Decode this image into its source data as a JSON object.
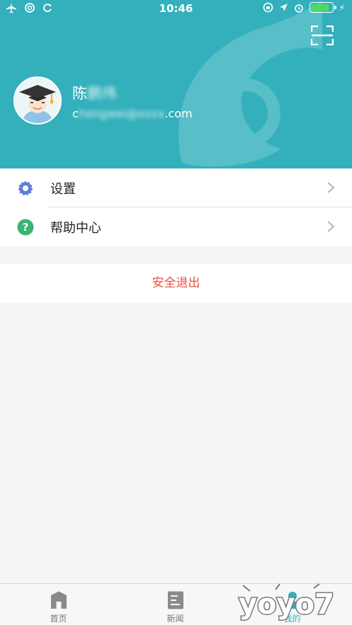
{
  "status_bar": {
    "time": "10:46"
  },
  "profile": {
    "name_visible": "陈",
    "name_blurred": "鹏伟",
    "email_start": "c",
    "email_blurred": "hengwei@xxxx",
    "email_end": ".com"
  },
  "menu": {
    "items": [
      {
        "label": "设置",
        "icon": "gear-icon",
        "icon_color": "#5b7fd6"
      },
      {
        "label": "帮助中心",
        "icon": "help-icon",
        "icon_color": "#3cb371"
      }
    ]
  },
  "logout": {
    "label": "安全退出",
    "color": "#e8533e"
  },
  "tabbar": {
    "tabs": [
      {
        "label": "首页",
        "icon": "home-icon"
      },
      {
        "label": "新闻",
        "icon": "news-icon"
      },
      {
        "label": "我的",
        "icon": "profile-icon",
        "active": true
      }
    ]
  },
  "colors": {
    "header": "#33b0bb",
    "accent": "#33b0bb"
  }
}
